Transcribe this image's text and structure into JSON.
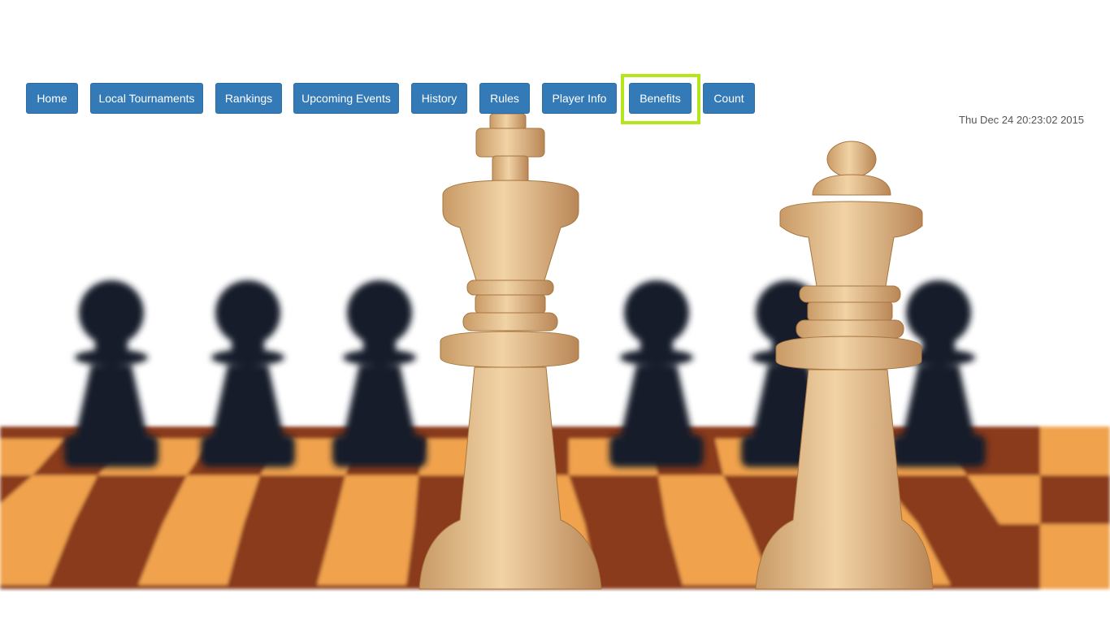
{
  "nav": {
    "items": [
      {
        "label": "Home",
        "name": "nav-home-button"
      },
      {
        "label": "Local Tournaments",
        "name": "nav-local-tournaments-button"
      },
      {
        "label": "Rankings",
        "name": "nav-rankings-button"
      },
      {
        "label": "Upcoming Events",
        "name": "nav-upcoming-events-button"
      },
      {
        "label": "History",
        "name": "nav-history-button"
      },
      {
        "label": "Rules",
        "name": "nav-rules-button"
      },
      {
        "label": "Player Info",
        "name": "nav-player-info-button"
      },
      {
        "label": "Benefits",
        "name": "nav-benefits-button"
      },
      {
        "label": "Count",
        "name": "nav-count-button"
      }
    ],
    "highlighted": "Benefits",
    "highlight_color": "#b5e61d",
    "button_color": "#337ab7"
  },
  "datetime": "Thu Dec 24 20:23:02 2015",
  "hero": {
    "icon": "chess-king-queen-image"
  }
}
